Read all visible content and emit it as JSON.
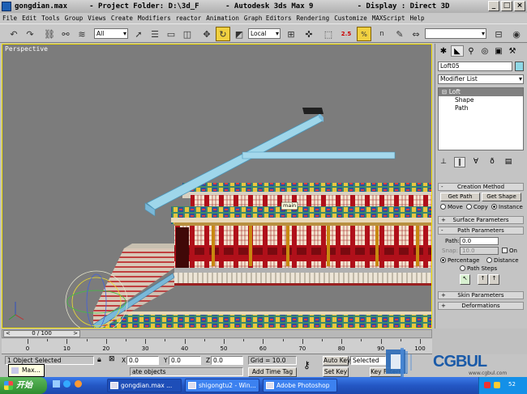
{
  "window": {
    "title": "gongdian.max     - Project Folder: D:\\3d_F      - Autodesk 3ds Max 9          - Display : Direct 3D",
    "min": "_",
    "max": "□",
    "close": "×"
  },
  "menu": [
    "File",
    "Edit",
    "Tools",
    "Group",
    "Views",
    "Create",
    "Modifiers",
    "reactor",
    "Animation",
    "Graph Editors",
    "Rendering",
    "Customize",
    "MAXScript",
    "Help"
  ],
  "toolbar": {
    "selection_filter": "All",
    "coord_system": "Local",
    "angle_snap": "2.5",
    "percent_snap": "%",
    "spinner_snap": "n",
    "named_selection": ""
  },
  "viewport": {
    "label": "Perspective",
    "object_tooltip": "main"
  },
  "command_panel": {
    "object_name": "Loft05",
    "object_color": "#8fd8e6",
    "modifier_list": "Modifier List",
    "stack": [
      {
        "label": "Loft",
        "sign": "⊟"
      },
      {
        "label": "Shape"
      },
      {
        "label": "Path"
      }
    ],
    "creation_method": {
      "title": "Creation Method",
      "get_path": "Get Path",
      "get_shape": "Get Shape",
      "move": "Move",
      "copy": "Copy",
      "instance": "Instance"
    },
    "surface_params": "Surface Parameters",
    "path_params": {
      "title": "Path Parameters",
      "path_label": "Path:",
      "path_value": "0.0",
      "snap_label": "Snap:",
      "snap_value": "10.0",
      "on_label": "On",
      "percentage": "Percentage",
      "distance": "Distance",
      "path_steps": "Path Steps"
    },
    "skin_params": "Skin Parameters",
    "deformations": "Deformations",
    "rollout_minus": "-",
    "rollout_plus": "+"
  },
  "timeline": {
    "slider": "0 / 100",
    "prev": "<",
    "next": ">",
    "ticks": [
      0,
      10,
      20,
      30,
      40,
      50,
      60,
      70,
      80,
      90,
      100
    ]
  },
  "status": {
    "selected": "1 Object Selected",
    "prompt_suffix": "ate objects",
    "x_label": "X",
    "x_value": "0.0",
    "y_label": "Y",
    "y_value": "0.0",
    "z_label": "Z",
    "z_value": "0.0",
    "grid": "Grid = 10.0",
    "add_time_tag": "Add Time Tag",
    "auto_key": "Auto Key",
    "set_key": "Set Key",
    "selected_dd": "Selected",
    "key_filters": "Key Filters...",
    "tooltip": "Max..."
  },
  "logo": {
    "text": "CGBUL",
    "subtext": "www.cgbul.com"
  },
  "taskbar": {
    "start": "开始",
    "tasks": [
      "gongdian.max ...",
      "shigongtu2 - Win...",
      "Adobe Photoshop"
    ],
    "badge": "52"
  }
}
